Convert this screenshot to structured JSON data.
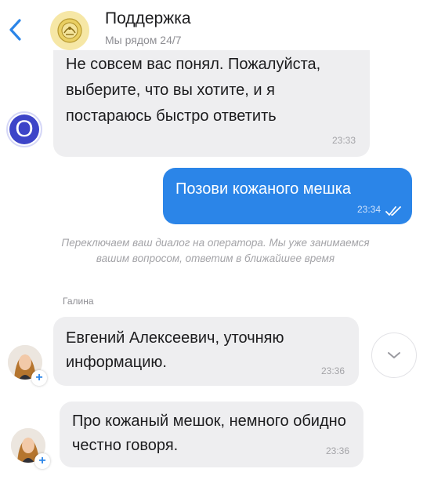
{
  "header": {
    "back_icon": "chevron-left-icon",
    "title": "Поддержка",
    "subtitle": "Мы рядом 24/7",
    "accent": "#2b85e8"
  },
  "messages": [
    {
      "direction": "incoming",
      "text": "Не совсем вас понял. Пожалуйста, выберите, что вы хотите, и я постараюсь быстро ответить",
      "time": "23:33",
      "avatar_letter": "O"
    },
    {
      "direction": "outgoing",
      "text": "Позови кожаного мешка",
      "time": "23:34",
      "status_icon": "double-check-icon"
    },
    {
      "direction": "incoming",
      "text": "Евгений Алексеевич, уточняю информацию.",
      "time": "23:36",
      "sender": "Галина"
    },
    {
      "direction": "incoming",
      "text": "Про кожаный мешок, немного обидно честно говоря.",
      "time": "23:36"
    }
  ],
  "system_message": "Переключаем ваш диалог на оператора. Мы уже занимаемся вашим вопросом, ответим в ближайшее время",
  "colors": {
    "outgoing_bubble": "#2b85e8",
    "incoming_bubble": "#eeeef0",
    "bot_avatar": "#3d44c8"
  }
}
